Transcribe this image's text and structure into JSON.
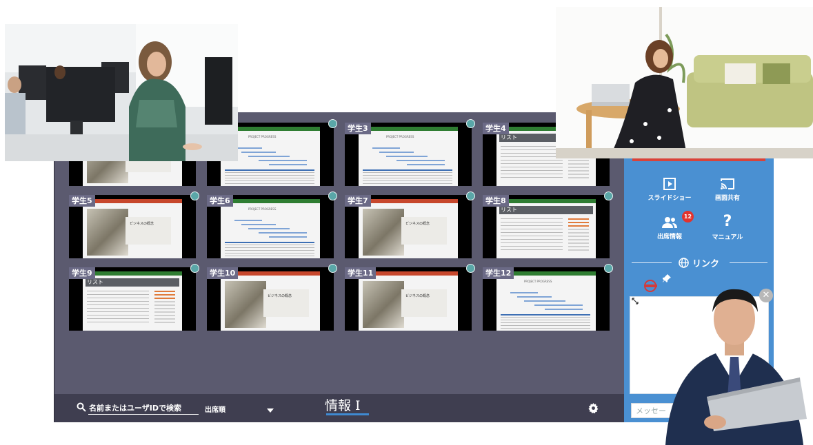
{
  "tiles": [
    {
      "label": "",
      "kind": "pp-top"
    },
    {
      "label": "",
      "kind": "xl-top"
    },
    {
      "label": "学生3",
      "kind": "xl"
    },
    {
      "label": "学生4",
      "kind": "list"
    },
    {
      "label": "学生5",
      "kind": "pp"
    },
    {
      "label": "学生6",
      "kind": "xl"
    },
    {
      "label": "学生7",
      "kind": "pp"
    },
    {
      "label": "学生8",
      "kind": "list"
    },
    {
      "label": "学生9",
      "kind": "list"
    },
    {
      "label": "学生10",
      "kind": "pp"
    },
    {
      "label": "学生11",
      "kind": "pp"
    },
    {
      "label": "学生12",
      "kind": "xl"
    }
  ],
  "slide_text": "ビジネスの概念",
  "list_text": "リスト",
  "chart_text": "PROJECT PROGRESS",
  "sidebar": {
    "slideshow_label": "スライドショー",
    "screen_share_label": "画面共有",
    "attendance_label": "出席情報",
    "attendance_badge": "12",
    "manual_label": "マニュアル",
    "link_title": "リンク",
    "message_placeholder": "メッセー"
  },
  "bottom": {
    "search_text": "名前またはユーザIDで検索",
    "sort_text": "出席順",
    "course_title": "情報 I"
  },
  "colors": {
    "panel": "#5b5a6f",
    "bottom_bar": "#3f3e50",
    "sidebar": "#4a90d2",
    "badge": "#e2332e",
    "label_bg": "#6b6a86"
  }
}
